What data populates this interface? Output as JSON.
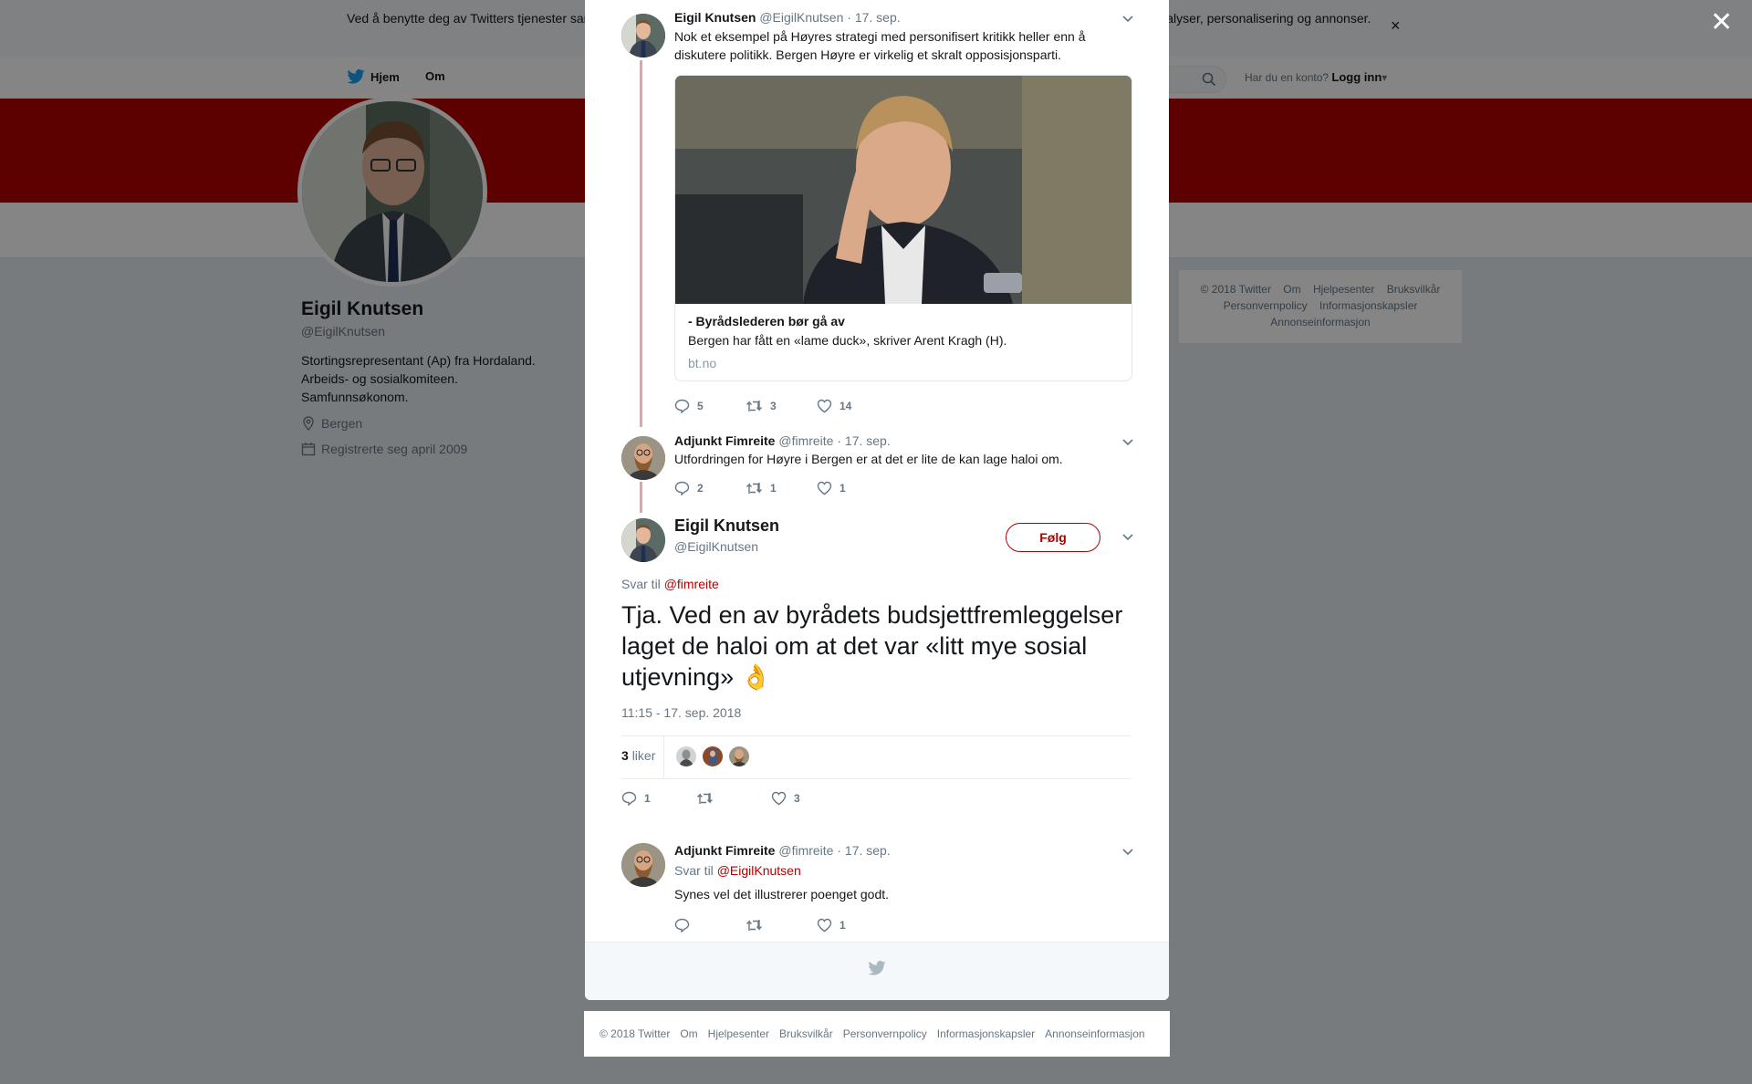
{
  "cookie_banner": {
    "text": "Ved å benytte deg av Twitters tjenester samtykker du i vår bruk av informasjonskapsler. Vi og våre partnere bruker informasjonskapsler til bl.a. analyser, personalisering og annonser."
  },
  "topnav": {
    "home_label": "Hjem",
    "about_label": "Om",
    "login_prompt": "Har du en konto?",
    "login_label": "Logg inn"
  },
  "profile": {
    "name": "Eigil Knutsen",
    "handle": "@EigilKnutsen",
    "bio_lines": [
      "Stortingsrepresentant (Ap) fra Hordaland.",
      "Arbeids- og sosialkomiteen.",
      "Samfunnsøkonom."
    ],
    "location": "Bergen",
    "joined": "Registrerte seg april 2009"
  },
  "side_footer": {
    "links": [
      "© 2018 Twitter",
      "Om",
      "Hjelpesenter",
      "Bruksvilkår",
      "Personvernpolicy",
      "Informasjonskapsler",
      "Annonseinformasjon"
    ]
  },
  "thread": {
    "tweet1": {
      "name": "Eigil Knutsen",
      "handle": "@EigilKnutsen",
      "date": "· 17. sep.",
      "text": "Nok et eksempel på Høyres strategi med personifisert kritikk heller enn å diskutere politikk. Bergen Høyre er virkelig et skralt opposisjonsparti.",
      "card": {
        "title": "- Byrådslederen bør gå av",
        "description": "Bergen har fått en «lame duck», skriver Arent Kragh (H).",
        "domain": "bt.no"
      },
      "replies": "5",
      "retweets": "3",
      "likes": "14"
    },
    "tweet2": {
      "name": "Adjunkt Fimreite",
      "handle": "@fimreite",
      "date": "· 17. sep.",
      "text": "Utfordringen for Høyre i Bergen er at det er lite de kan lage haloi om.",
      "replies": "2",
      "retweets": "1",
      "likes": "1"
    },
    "main": {
      "name": "Eigil Knutsen",
      "handle": "@EigilKnutsen",
      "follow_label": "Følg",
      "reply_prefix": "Svar til",
      "reply_handle": "@fimreite",
      "text": "Tja. Ved en av byrådets budsjettfremleggelser laget de haloi om at det var «litt mye sosial utjevning» 👌",
      "timestamp": "11:15 - 17. sep. 2018",
      "likes_count": "3",
      "likes_label": "liker",
      "replies": "1",
      "retweets": "",
      "likes": "3"
    },
    "reply": {
      "name": "Adjunkt Fimreite",
      "handle": "@fimreite",
      "date": "· 17. sep.",
      "reply_prefix": "Svar til",
      "reply_handle": "@EigilKnutsen",
      "text": "Synes vel det illustrerer poenget godt.",
      "replies": "",
      "retweets": "",
      "likes": "1"
    }
  },
  "bottom_footer": {
    "links": [
      "© 2018 Twitter",
      "Om",
      "Hjelpesenter",
      "Bruksvilkår",
      "Personvernpolicy",
      "Informasjonskapsler",
      "Annonseinformasjon"
    ]
  },
  "colors": {
    "accent": "#b00000",
    "text_secondary": "#657786",
    "thread_line": "#e3a3a8"
  }
}
